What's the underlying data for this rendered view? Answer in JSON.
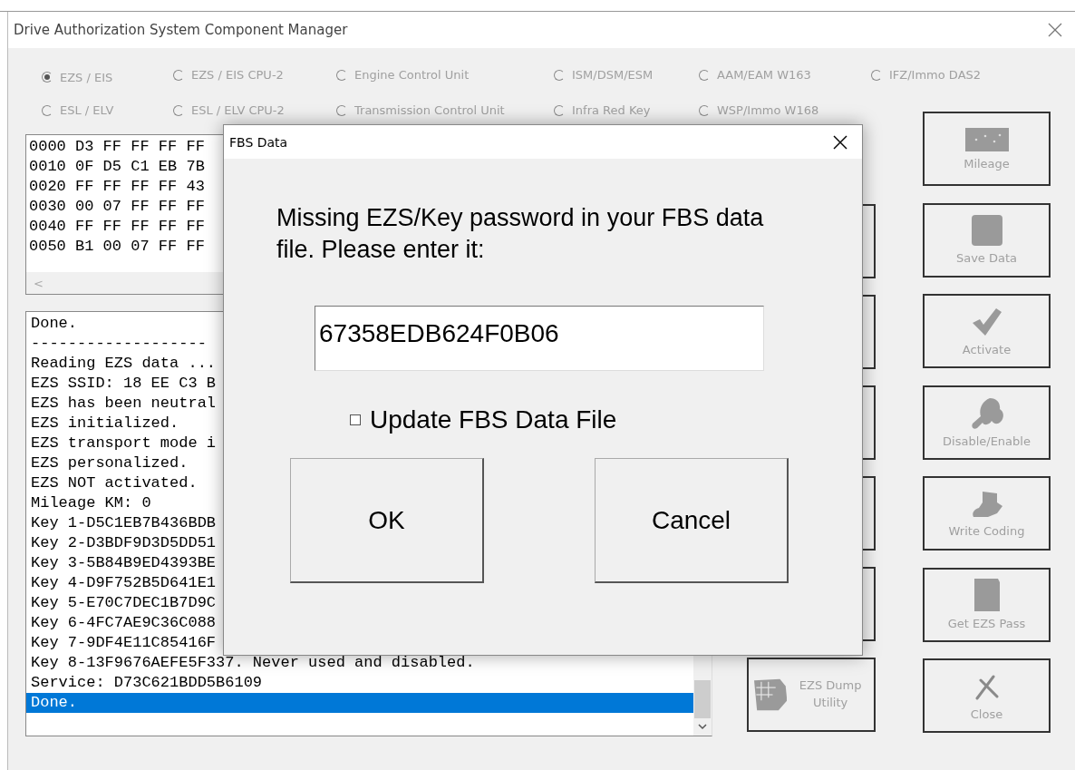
{
  "window": {
    "title": "Drive Authorization System Component Manager"
  },
  "component_options": [
    {
      "label": "EZS / EIS",
      "selected": true,
      "disabled": true
    },
    {
      "label": "EZS / EIS CPU-2",
      "selected": false,
      "disabled": true
    },
    {
      "label": "Engine Control Unit",
      "selected": false,
      "disabled": true
    },
    {
      "label": "ISM/DSM/ESM",
      "selected": false,
      "disabled": true
    },
    {
      "label": "AAM/EAM W163",
      "selected": false,
      "disabled": true
    },
    {
      "label": "IFZ/Immo DAS2",
      "selected": false,
      "disabled": true
    },
    {
      "label": "ESL / ELV",
      "selected": false,
      "disabled": true
    },
    {
      "label": "ESL / ELV CPU-2",
      "selected": false,
      "disabled": true
    },
    {
      "label": "Transmission Control Unit",
      "selected": false,
      "disabled": true
    },
    {
      "label": "Infra Red Key",
      "selected": false,
      "disabled": true
    },
    {
      "label": "WSP/Immo W168",
      "selected": false,
      "disabled": true
    }
  ],
  "hex_dump": {
    "lines": [
      "0000 D3 FF FF FF FF",
      "0010 0F D5 C1 EB 7B",
      "0020 FF FF FF FF 43",
      "0030 00 07 FF FF FF",
      "0040 FF FF FF FF FF",
      "0050 B1 00 07 FF FF"
    ],
    "scroll_left": "<"
  },
  "log": {
    "lines": [
      {
        "text": "Done.",
        "selected": false
      },
      {
        "text": "-------------------",
        "selected": false
      },
      {
        "text": "Reading EZS data ...",
        "selected": false
      },
      {
        "text": "EZS SSID: 18 EE C3 B",
        "selected": false
      },
      {
        "text": "EZS has been neutral",
        "selected": false
      },
      {
        "text": "EZS initialized.",
        "selected": false
      },
      {
        "text": "EZS transport mode i",
        "selected": false
      },
      {
        "text": "EZS personalized.",
        "selected": false
      },
      {
        "text": "EZS NOT activated.",
        "selected": false
      },
      {
        "text": "Mileage KM: 0",
        "selected": false
      },
      {
        "text": "Key 1-D5C1EB7B436BDB",
        "selected": false
      },
      {
        "text": "Key 2-D3BDF9D3D5DD51",
        "selected": false
      },
      {
        "text": "Key 3-5B84B9ED4393BE",
        "selected": false
      },
      {
        "text": "Key 4-D9F752B5D641E1",
        "selected": false
      },
      {
        "text": "Key 5-E70C7DEC1B7D9C",
        "selected": false
      },
      {
        "text": "Key 6-4FC7AE9C36C088",
        "selected": false
      },
      {
        "text": "Key 7-9DF4E11C85416F",
        "selected": false
      },
      {
        "text": "Key 8-13F9676AEFE5F337. Never used and disabled.",
        "selected": false
      },
      {
        "text": "Service: D73C621BDD5B6109",
        "selected": false
      },
      {
        "text": "Done.",
        "selected": true
      }
    ]
  },
  "dump_utility_button": {
    "label": "EZS Dump Utility",
    "disabled": true
  },
  "actions": [
    {
      "label": "Mileage",
      "disabled": true
    },
    {
      "label": "Save Data",
      "disabled": true
    },
    {
      "label": "Activate",
      "disabled": true
    },
    {
      "label": "Disable/Enable",
      "disabled": true
    },
    {
      "label": "Write Coding",
      "disabled": true
    },
    {
      "label": "Get EZS Pass",
      "disabled": true
    },
    {
      "label": "Close",
      "disabled": true
    }
  ],
  "dialog": {
    "title": "FBS Data",
    "message": "Missing EZS/Key password in your FBS data file. Please enter it:",
    "password": {
      "value": "67358EDB624F0B06"
    },
    "update_checkbox": {
      "label": "Update FBS Data File",
      "checked": false
    },
    "buttons": [
      "OK",
      "Cancel"
    ]
  }
}
